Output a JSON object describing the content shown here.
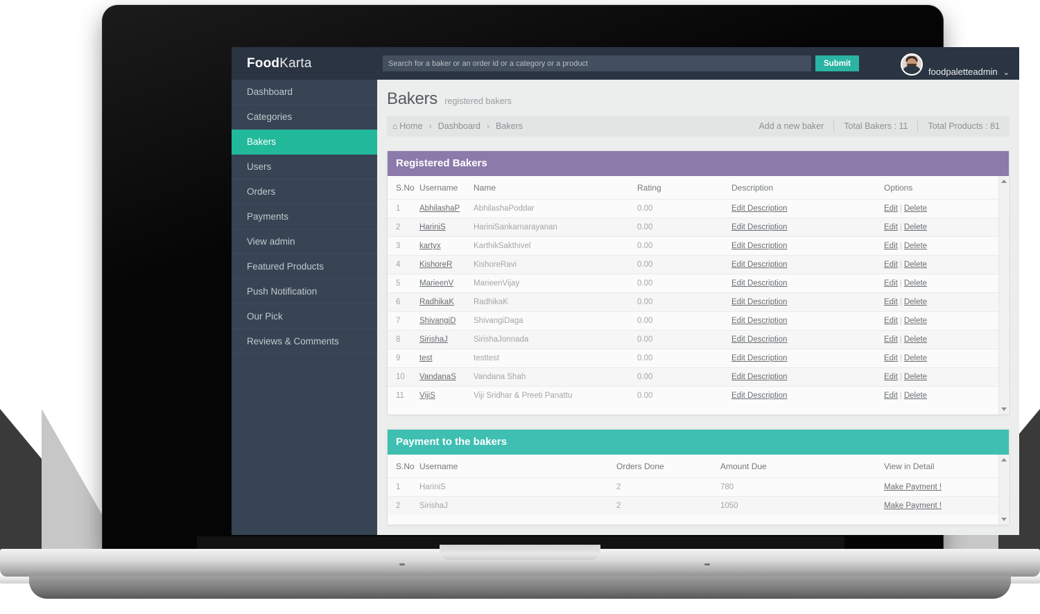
{
  "brand": {
    "bold": "Food",
    "light": "Karta"
  },
  "search": {
    "placeholder": "Search for a baker or an order id or a category or a product",
    "value": "",
    "submit_label": "Submit"
  },
  "user": {
    "name": "foodpaletteadmin",
    "caret": "⌄",
    "avatar_icon": "user-avatar"
  },
  "sidebar": {
    "items": [
      {
        "label": "Dashboard",
        "active": false
      },
      {
        "label": "Categories",
        "active": false
      },
      {
        "label": "Bakers",
        "active": true
      },
      {
        "label": "Users",
        "active": false
      },
      {
        "label": "Orders",
        "active": false
      },
      {
        "label": "Payments",
        "active": false
      },
      {
        "label": "View admin",
        "active": false
      },
      {
        "label": "Featured Products",
        "active": false
      },
      {
        "label": "Push Notification",
        "active": false
      },
      {
        "label": "Our Pick",
        "active": false
      },
      {
        "label": "Reviews & Comments",
        "active": false
      }
    ]
  },
  "page": {
    "title": "Bakers",
    "subtitle": "registered bakers"
  },
  "breadcrumb": {
    "home_icon": "home-icon",
    "items": [
      "Home",
      "Dashboard",
      "Bakers"
    ],
    "separator": "›",
    "stats": [
      {
        "label": "Add a new baker",
        "link": true
      },
      {
        "label": "Total Bakers : 11",
        "link": false
      },
      {
        "label": "Total Products : 81",
        "link": false
      }
    ]
  },
  "bakers_panel": {
    "title": "Registered Bakers",
    "accent": "#8c7aab",
    "columns": [
      "S.No",
      "Username",
      "Name",
      "Rating",
      "Description",
      "Options"
    ],
    "edit_description_label": "Edit Description",
    "edit_label": "Edit",
    "delete_label": "Delete",
    "pipe": "|",
    "rows": [
      {
        "sno": "1",
        "username": "AbhilashaP",
        "name": "AbhilashaPoddar",
        "rating": "0.00"
      },
      {
        "sno": "2",
        "username": "HariniS",
        "name": "HariniSankarnarayanan",
        "rating": "0.00"
      },
      {
        "sno": "3",
        "username": "kartyx",
        "name": "KarthikSakthivel",
        "rating": "0.00"
      },
      {
        "sno": "4",
        "username": "KishoreR",
        "name": "KishoreRavi",
        "rating": "0.00"
      },
      {
        "sno": "5",
        "username": "MarieenV",
        "name": "MarieenVijay",
        "rating": "0.00"
      },
      {
        "sno": "6",
        "username": "RadhikaK",
        "name": "RadhikaK",
        "rating": "0.00"
      },
      {
        "sno": "7",
        "username": "ShivangiD",
        "name": "ShivangiDaga",
        "rating": "0.00"
      },
      {
        "sno": "8",
        "username": "SirishaJ",
        "name": "SirishaJonnada",
        "rating": "0.00"
      },
      {
        "sno": "9",
        "username": "test",
        "name": "testtest",
        "rating": "0.00"
      },
      {
        "sno": "10",
        "username": "VandanaS",
        "name": "Vandana Shah",
        "rating": "0.00"
      },
      {
        "sno": "11",
        "username": "VijiS",
        "name": "Viji Sridhar & Preeti Panattu",
        "rating": "0.00"
      }
    ]
  },
  "payments_panel": {
    "title": "Payment to the bakers",
    "accent": "#3ebfb2",
    "columns": [
      "S.No",
      "Username",
      "Orders Done",
      "Amount Due",
      "View in Detail"
    ],
    "make_payment_label": "Make Payment !",
    "rows": [
      {
        "sno": "1",
        "username": "HariniS",
        "orders": "2",
        "amount": "780"
      },
      {
        "sno": "2",
        "username": "SirishaJ",
        "orders": "2",
        "amount": "1050"
      }
    ]
  },
  "colors": {
    "header_bg": "#2a3442",
    "sidebar_bg": "#364453",
    "accent_teal": "#22b99a",
    "accent_purple": "#8c7aab",
    "content_bg": "#eceded"
  }
}
